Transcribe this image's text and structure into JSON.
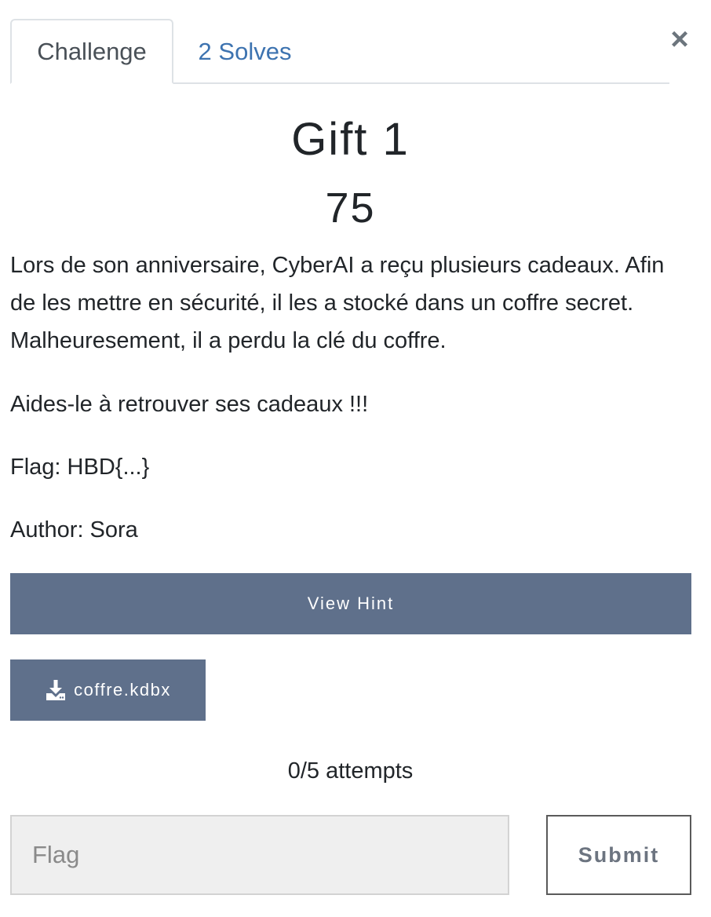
{
  "tabs": [
    {
      "label": "Challenge",
      "active": true
    },
    {
      "label": "2 Solves",
      "active": false
    }
  ],
  "close_icon": "×",
  "challenge": {
    "name": "Gift 1",
    "value": "75",
    "description": [
      "Lors de son anniversaire, CyberAI a reçu plusieurs cadeaux. Afin de les mettre en sécurité, il les a stocké dans un coffre secret. Malheuresement, il a perdu la clé du coffre.",
      "Aides-le à retrouver ses cadeaux !!!",
      "Flag: HBD{...}",
      "Author: Sora"
    ]
  },
  "hint_button": {
    "label": "View Hint"
  },
  "file": {
    "name": "coffre.kdbx",
    "icon": "download-icon"
  },
  "attempts": "0/5 attempts",
  "flag_input": {
    "placeholder": "Flag",
    "value": ""
  },
  "submit_button": {
    "label": "Submit"
  },
  "colors": {
    "button_bg": "#5f708b",
    "tab_link": "#3d73b0",
    "input_bg": "#efefef"
  }
}
